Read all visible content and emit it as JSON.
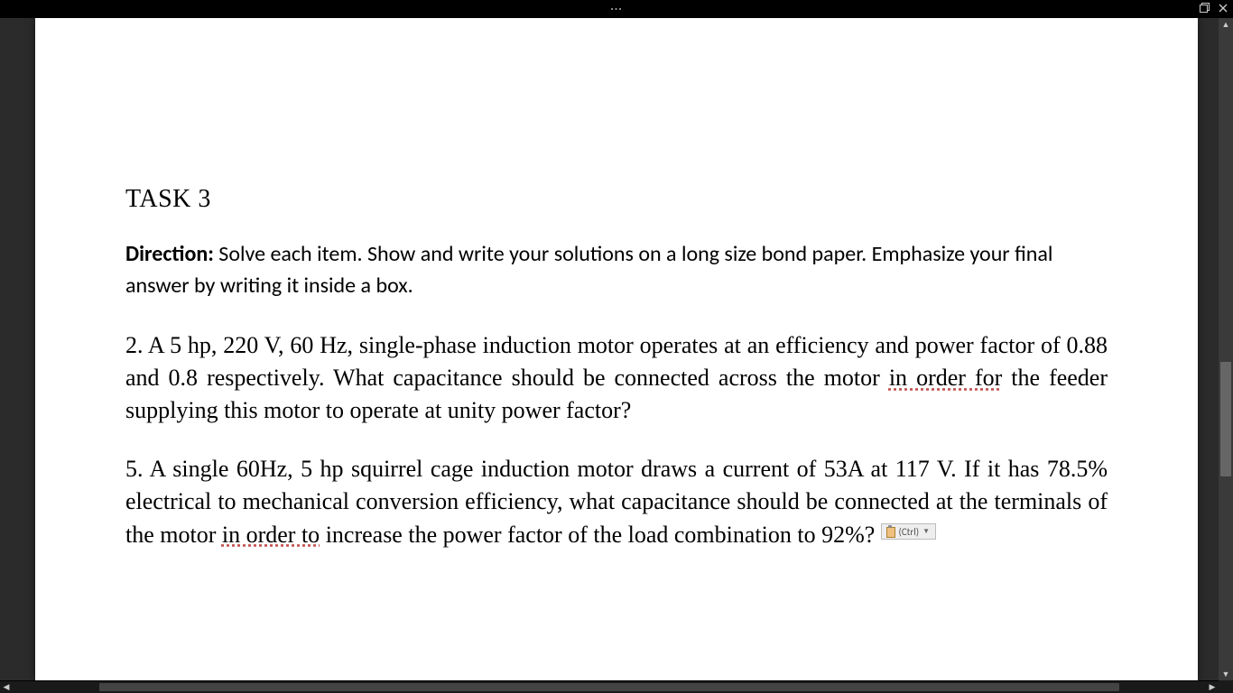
{
  "titlebar": {
    "ellipsis": "···"
  },
  "document": {
    "task_title": "TASK 3",
    "direction_label": "Direction:",
    "direction_text": " Solve each item. Show and write your solutions on a long size bond paper. Emphasize your final answer by writing it inside a box.",
    "q2_pre": "2. A 5 hp, 220 V, 60 Hz, single-phase induction motor operates at an efficiency and power factor of 0.88 and 0.8 respectively. What capacitance should be connected across the motor ",
    "q2_underlined": "in order for",
    "q2_post": " the feeder supplying this motor to operate at unity power factor?",
    "q5_pre": "5. A single 60Hz, 5 hp squirrel cage induction motor draws a current of 53A at 117 V. If it has 78.5% electrical to mechanical conversion efficiency, what capacitance should be connected at the terminals of the motor ",
    "q5_underlined": "in order to",
    "q5_post": " increase the power factor of the load combination to 92%?"
  },
  "paste_options": {
    "label": "(Ctrl)"
  }
}
